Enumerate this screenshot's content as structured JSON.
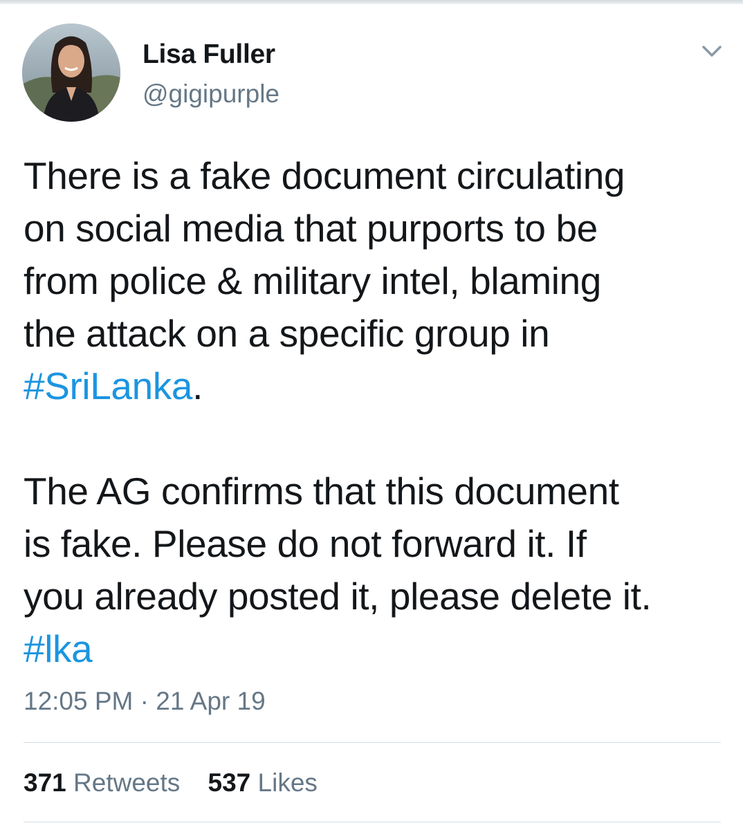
{
  "author": {
    "display_name": "Lisa Fuller",
    "handle": "@gigipurple",
    "avatar_icon": "profile-photo"
  },
  "menu_icon": "chevron-down-icon",
  "tweet": {
    "paragraph1": [
      "There is a fake document circulating",
      "on social media that purports to be",
      "from police & military intel, blaming",
      "the attack on a specific group in"
    ],
    "hashtag1": "#SriLanka",
    "hashtag1_suffix": ".",
    "paragraph2": [
      "The AG confirms that this document",
      "is fake. Please do not forward it. If",
      "you already posted it, please delete it."
    ],
    "hashtag2": "#lka"
  },
  "timestamp": {
    "time": "12:05 PM",
    "separator": "·",
    "date": "21 Apr 19"
  },
  "stats": {
    "retweets_count": "371",
    "retweets_label": "Retweets",
    "likes_count": "537",
    "likes_label": "Likes"
  },
  "colors": {
    "text": "#14171a",
    "secondary": "#657786",
    "link": "#1b95e0",
    "divider": "#d3dde5"
  }
}
